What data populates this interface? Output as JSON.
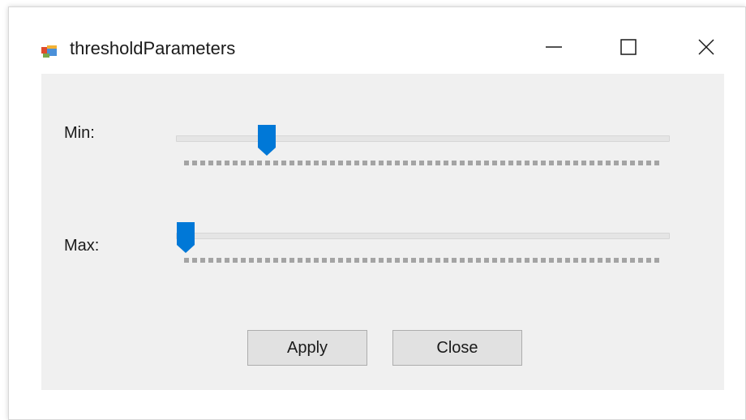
{
  "window": {
    "title": "thresholdParameters",
    "icon": "app-window-icon",
    "controls": [
      "minimize-icon",
      "maximize-icon",
      "close-icon"
    ]
  },
  "sliders": [
    {
      "label": "Min:",
      "value_fraction": 0.17
    },
    {
      "label": "Max:",
      "value_fraction": 0.0
    }
  ],
  "buttons": {
    "apply_label": "Apply",
    "close_label": "Close"
  },
  "colors": {
    "accent": "#0078d7",
    "client_background": "#f0f0f0",
    "button_face": "#e1e1e1"
  }
}
